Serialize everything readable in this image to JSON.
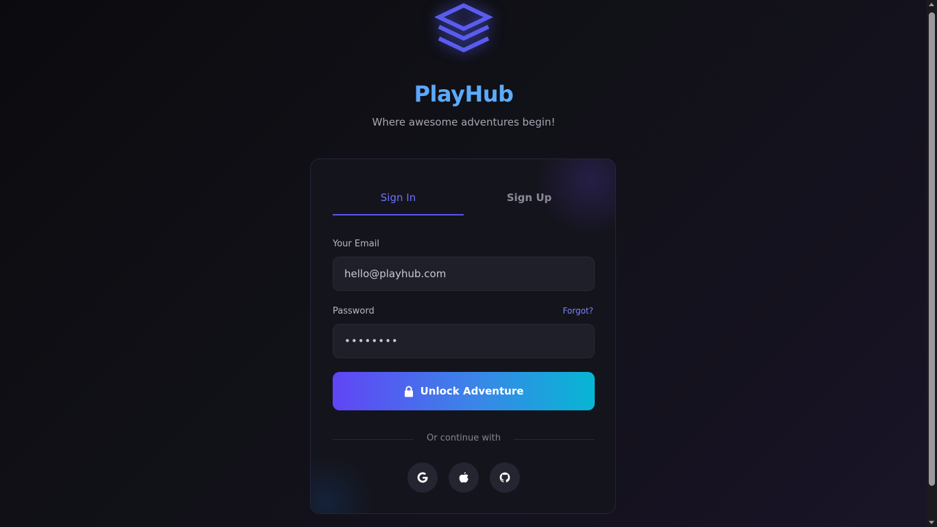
{
  "brand": {
    "title": "PlayHub",
    "tagline": "Where awesome adventures begin!",
    "logo_icon": "stacked-layers-icon",
    "accent_color": "#5b55f2"
  },
  "auth": {
    "tabs": [
      {
        "label": "Sign In",
        "active": true
      },
      {
        "label": "Sign Up",
        "active": false
      }
    ],
    "email": {
      "label": "Your Email",
      "value": "hello@playhub.com"
    },
    "password": {
      "label": "Password",
      "value": "••••••••",
      "forgot_label": "Forgot?"
    },
    "submit": {
      "label": "Unlock Adventure",
      "icon": "lock-icon"
    },
    "divider_text": "Or continue with",
    "social": [
      {
        "name": "google",
        "icon": "google-icon"
      },
      {
        "name": "apple",
        "icon": "apple-icon"
      },
      {
        "name": "github",
        "icon": "github-icon"
      }
    ]
  }
}
